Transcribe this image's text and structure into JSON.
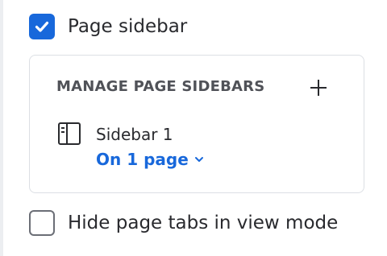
{
  "page_sidebar": {
    "label": "Page sidebar",
    "checked": true,
    "check_icon": "check-icon"
  },
  "manage": {
    "heading": "MANAGE PAGE SIDEBARS",
    "add_icon": "plus-icon",
    "sidebars": [
      {
        "icon": "sidebar-layout-icon",
        "name": "Sidebar 1",
        "pages_link": "On 1 page",
        "dropdown_icon": "chevron-down-icon"
      }
    ]
  },
  "hide_tabs": {
    "label": "Hide page tabs in view mode",
    "checked": false
  },
  "colors": {
    "accent": "#1868db",
    "border": "#dcdfe4",
    "heading": "#505258",
    "text": "#292a2e"
  }
}
